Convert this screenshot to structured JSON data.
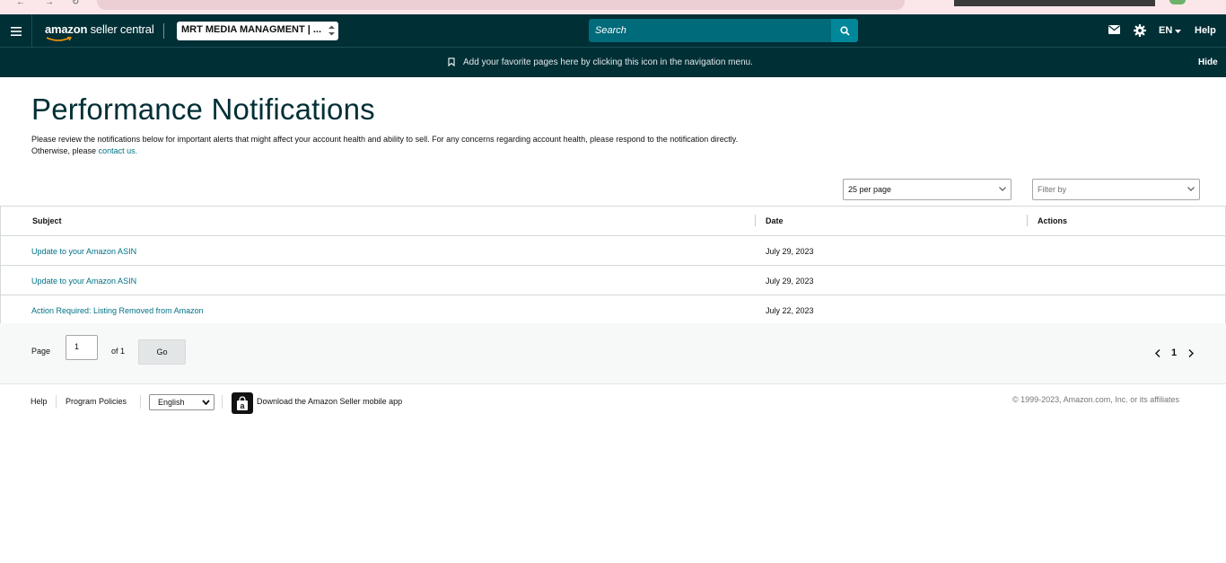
{
  "nav": {
    "logo_amazon": "amazon",
    "logo_seller_central": "seller central",
    "account_name": "MRT MEDIA MANAGMENT | ...",
    "search_placeholder": "Search",
    "language": "EN",
    "help": "Help"
  },
  "bookmark_bar": {
    "text": "Add your favorite pages here by clicking this icon in the navigation menu.",
    "hide": "Hide"
  },
  "page": {
    "title": "Performance Notifications",
    "description": "Please review the notifications below for important alerts that might affect your account health and ability to sell. For any concerns regarding account health, please respond to the notification directly.",
    "description_line2": "Otherwise, please",
    "contact_link": "contact us."
  },
  "controls": {
    "per_page": "25 per page",
    "filter_by": "Filter by"
  },
  "table": {
    "headers": [
      "Subject",
      "Date",
      "Actions"
    ],
    "rows": [
      {
        "subject": "Update to your Amazon ASIN",
        "date": "July 29, 2023"
      },
      {
        "subject": "Update to your Amazon ASIN",
        "date": "July 29, 2023"
      },
      {
        "subject": "Action Required: Listing Removed from Amazon",
        "date": "July 22, 2023"
      }
    ]
  },
  "pagination": {
    "page_label": "Page",
    "page_value": "1",
    "of_label": "of 1",
    "go": "Go",
    "current": "1"
  },
  "footer": {
    "help": "Help",
    "policies": "Program Policies",
    "language": "English",
    "app_text": "Download the Amazon Seller mobile app",
    "copyright": "© 1999-2023, Amazon.com, Inc. or its affiliates"
  },
  "colors": {
    "nav_bg": "#002f36",
    "search_bg": "#006b7a",
    "link": "#007185"
  }
}
